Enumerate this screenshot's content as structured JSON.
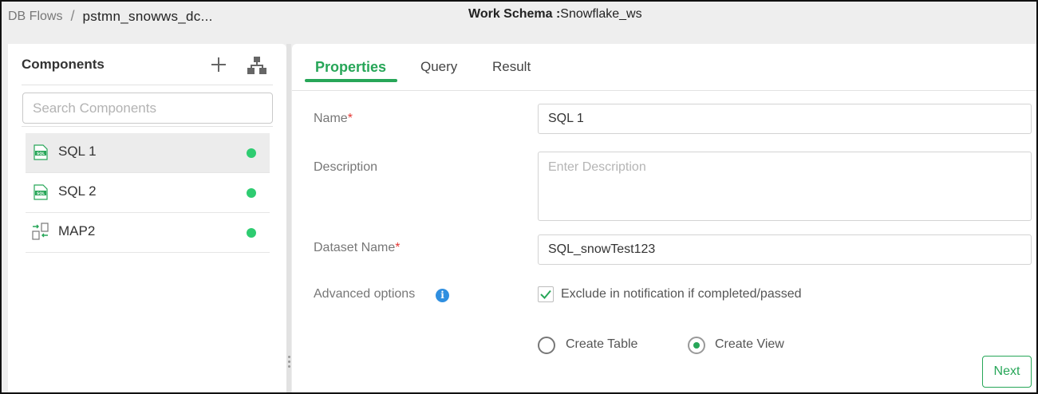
{
  "header": {
    "breadcrumb_root": "DB Flows",
    "breadcrumb_separator": "/",
    "breadcrumb_current": "pstmn_snowws_dc...",
    "schema_label": "Work Schema :",
    "schema_value": "Snowflake_ws"
  },
  "components_panel": {
    "title": "Components",
    "add_icon": "plus-icon",
    "layout_icon": "hierarchy-icon",
    "search_placeholder": "Search Components",
    "items": [
      {
        "label": "SQL 1",
        "icon": "sql-file-icon",
        "status_color": "#2ecc71",
        "active": true
      },
      {
        "label": "SQL 2",
        "icon": "sql-file-icon",
        "status_color": "#2ecc71",
        "active": false
      },
      {
        "label": "MAP2",
        "icon": "map-transfer-icon",
        "status_color": "#2ecc71",
        "active": false
      }
    ]
  },
  "tabs": [
    {
      "label": "Properties",
      "active": true
    },
    {
      "label": "Query",
      "active": false
    },
    {
      "label": "Result",
      "active": false
    }
  ],
  "form": {
    "name_label": "Name",
    "required_mark": "*",
    "name_value": "SQL 1",
    "description_label": "Description",
    "description_placeholder": "Enter Description",
    "dataset_label": "Dataset Name",
    "dataset_value": "SQL_snowTest123",
    "advanced_label": "Advanced options",
    "info_glyph": "i",
    "exclude_label": "Exclude in notification if completed/passed",
    "exclude_checked": true,
    "create_table_label": "Create Table",
    "create_view_label": "Create View",
    "selected_mode": "Create View"
  },
  "actions": {
    "next_label": "Next"
  },
  "colors": {
    "accent_green": "#27a658",
    "status_green": "#2ecc71",
    "info_blue": "#2f8fe0",
    "required_red": "#e53935"
  }
}
